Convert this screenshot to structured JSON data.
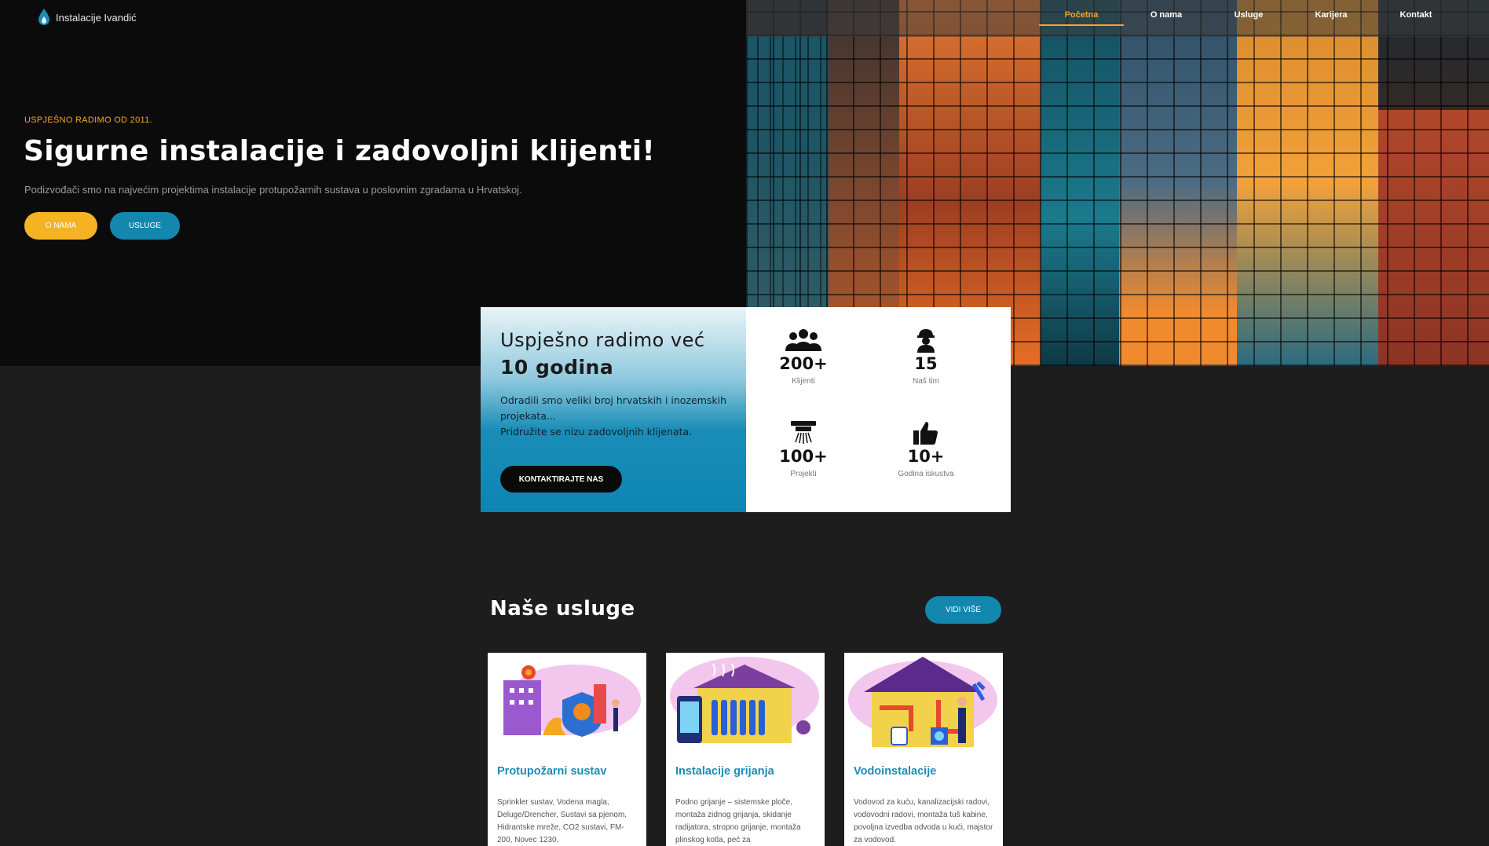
{
  "brand": {
    "name": "Instalacije Ivandić",
    "accent": "#f4a623",
    "blue": "#1387ad"
  },
  "nav": {
    "items": [
      {
        "label": "Početna",
        "active": true
      },
      {
        "label": "O nama",
        "active": false
      },
      {
        "label": "Usluge",
        "active": false
      },
      {
        "label": "Karijera",
        "active": false
      },
      {
        "label": "Kontakt",
        "active": false
      }
    ]
  },
  "hero": {
    "kicker": "USPJEŠNO RADIMO OD 2011.",
    "title": "Sigurne instalacije i zadovoljni klijenti!",
    "subtitle": "Podizvođači smo na najvećim projektima instalacije protupožarnih sustava u poslovnim zgradama u Hrvatskoj.",
    "btn_primary": "O NAMA",
    "btn_secondary": "USLUGE"
  },
  "stats": {
    "heading_line1": "Uspješno radimo već",
    "heading_line2": "10 godina",
    "text_line1": "Odradili smo veliki broj hrvatskih i inozemskih projekata...",
    "text_line2": "Pridružite se nizu zadovoljnih klijenata.",
    "button": "KONTAKTIRAJTE NAS",
    "items": [
      {
        "icon": "group-icon",
        "value": "200+",
        "label": "Klijenti"
      },
      {
        "icon": "worker-icon",
        "value": "15",
        "label": "Naš tim"
      },
      {
        "icon": "sprinkler-icon",
        "value": "100+",
        "label": "Projekti"
      },
      {
        "icon": "thumbs-up-icon",
        "value": "10+",
        "label": "Godina iskustva"
      }
    ]
  },
  "services": {
    "title": "Naše usluge",
    "button": "VIDI VIŠE",
    "cards": [
      {
        "title": "Protupožarni sustav",
        "text": "Sprinkler sustav, Vodena magla, Deluge/Drencher, Sustavi sa pjenom, Hidrantske mreže, CO2 sustavi, FM-200, Novec 1230,"
      },
      {
        "title": "Instalacije grijanja",
        "text": "Podno grijanje – sistemske ploče, montaža zidnog grijanja, skidanje radijatora, stropno grijanje, montaža plinskog kotla, peć za"
      },
      {
        "title": "Vodoinstalacije",
        "text": "Vodovod za kuću, kanalizacijski radovi, vodovodni radovi, montaža tuš kabine, povoljna izvedba odvoda u kući, majstor za vodovod."
      }
    ]
  }
}
